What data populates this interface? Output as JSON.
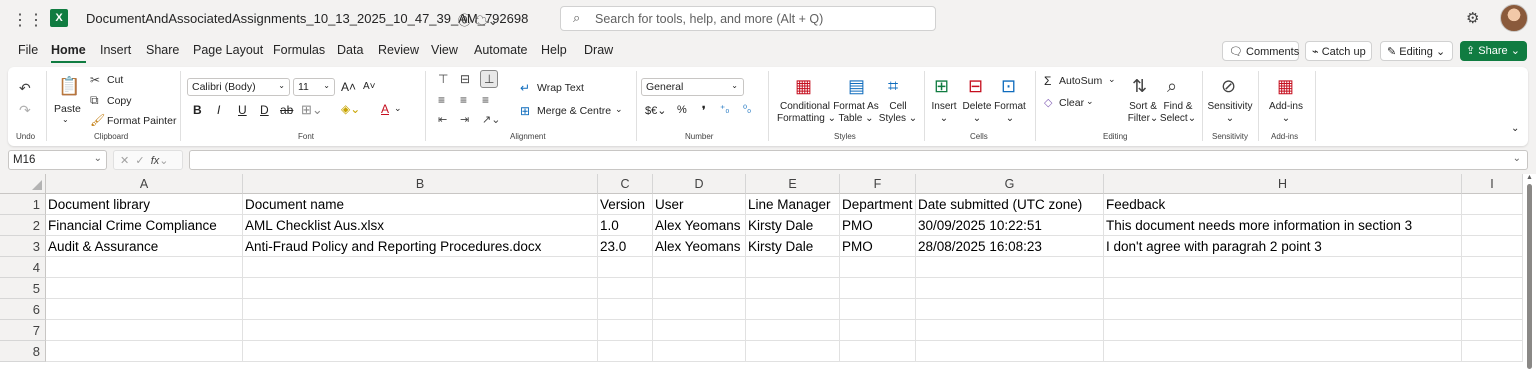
{
  "title_bar": {
    "app_icon": "excel-icon",
    "doc_title": "DocumentAndAssociatedAssignments_10_13_2025_10_47_39_AM_792698",
    "search_placeholder": "Search for tools, help, and more (Alt + Q)"
  },
  "menu": {
    "tabs": [
      "File",
      "Home",
      "Insert",
      "Share",
      "Page Layout",
      "Formulas",
      "Data",
      "Review",
      "View",
      "Automate",
      "Help",
      "Draw"
    ],
    "active_tab": "Home",
    "comments": "Comments",
    "catch_up": "Catch up",
    "editing": "Editing",
    "share": "Share"
  },
  "ribbon": {
    "undo_group": "Undo",
    "clipboard": {
      "paste": "Paste",
      "cut": "Cut",
      "copy": "Copy",
      "format_painter": "Format Painter",
      "group": "Clipboard"
    },
    "font": {
      "name": "Calibri (Body)",
      "size": "11",
      "group": "Font"
    },
    "alignment": {
      "wrap_text": "Wrap Text",
      "merge": "Merge & Centre",
      "group": "Alignment"
    },
    "number": {
      "format": "General",
      "group": "Number"
    },
    "styles": {
      "conditional_1": "Conditional",
      "conditional_2": "Formatting",
      "format_as_1": "Format As",
      "format_as_2": "Table",
      "cell_1": "Cell",
      "cell_2": "Styles",
      "group": "Styles"
    },
    "cells": {
      "insert": "Insert",
      "delete": "Delete",
      "format": "Format",
      "group": "Cells"
    },
    "editing": {
      "autosum": "AutoSum",
      "clear": "Clear",
      "sort_1": "Sort &",
      "sort_2": "Filter",
      "find_1": "Find &",
      "find_2": "Select",
      "group": "Editing"
    },
    "sensitivity": {
      "label": "Sensitivity",
      "group": "Sensitivity"
    },
    "addins": {
      "label": "Add-ins",
      "group": "Add-ins"
    }
  },
  "formula_bar": {
    "name_box": "M16",
    "formula": ""
  },
  "columns": [
    "A",
    "B",
    "C",
    "D",
    "E",
    "F",
    "G",
    "H",
    "I"
  ],
  "rows": [
    [
      "Document library",
      "Document name",
      "Version",
      "User",
      "Line Manager",
      "Department",
      "Date submitted (UTC zone)",
      "Feedback",
      ""
    ],
    [
      "Financial Crime Compliance",
      "AML Checklist Aus.xlsx",
      "1.0",
      "Alex Yeomans",
      "Kirsty Dale",
      "PMO",
      "30/09/2025 10:22:51",
      "This document needs more information in section 3",
      ""
    ],
    [
      "Audit & Assurance",
      "Anti-Fraud Policy and Reporting Procedures.docx",
      "23.0",
      "Alex Yeomans",
      "Kirsty Dale",
      "PMO",
      "28/08/2025 16:08:23",
      "I don't agree with paragrah 2 point 3",
      ""
    ],
    [
      "",
      "",
      "",
      "",
      "",
      "",
      "",
      "",
      ""
    ],
    [
      "",
      "",
      "",
      "",
      "",
      "",
      "",
      "",
      ""
    ],
    [
      "",
      "",
      "",
      "",
      "",
      "",
      "",
      "",
      ""
    ],
    [
      "",
      "",
      "",
      "",
      "",
      "",
      "",
      "",
      ""
    ],
    [
      "",
      "",
      "",
      "",
      "",
      "",
      "",
      "",
      ""
    ]
  ],
  "row_numbers": [
    "1",
    "2",
    "3",
    "4",
    "5",
    "6",
    "7",
    "8"
  ],
  "colors": {
    "accent": "#107c41"
  }
}
